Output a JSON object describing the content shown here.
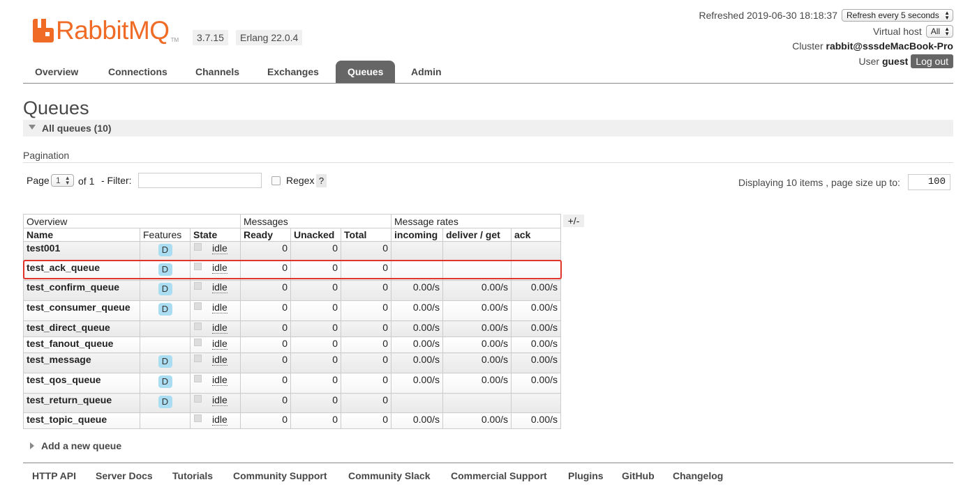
{
  "header": {
    "logo_text": "RabbitMQ",
    "logo_tm": "TM",
    "version": "3.7.15",
    "erlang": "Erlang 22.0.4"
  },
  "topright": {
    "refreshed_label": "Refreshed 2019-06-30 18:18:37",
    "refresh_select": "Refresh every 5 seconds",
    "vhost_label": "Virtual host",
    "vhost_select": "All",
    "cluster_label": "Cluster",
    "cluster_name": "rabbit@sssdeMacBook-Pro",
    "user_label": "User",
    "user_name": "guest",
    "logout": "Log out"
  },
  "tabs": [
    {
      "label": "Overview",
      "active": false
    },
    {
      "label": "Connections",
      "active": false
    },
    {
      "label": "Channels",
      "active": false
    },
    {
      "label": "Exchanges",
      "active": false
    },
    {
      "label": "Queues",
      "active": true
    },
    {
      "label": "Admin",
      "active": false
    }
  ],
  "page": {
    "title": "Queues",
    "section": "All queues (10)",
    "pagination_title": "Pagination",
    "page_label": "Page",
    "page_value": "1",
    "of_label": "of 1",
    "filter_label": "- Filter:",
    "filter_value": "",
    "regex_label": "Regex",
    "help": "?",
    "displaying": "Displaying 10 items , page size up to:",
    "page_size": "100",
    "plusminus": "+/-",
    "add_queue": "Add a new queue"
  },
  "table": {
    "groups": [
      "Overview",
      "Messages",
      "Message rates"
    ],
    "columns": [
      "Name",
      "Features",
      "State",
      "Ready",
      "Unacked",
      "Total",
      "incoming",
      "deliver / get",
      "ack"
    ],
    "rows": [
      {
        "name": "test001",
        "durable": true,
        "state": "idle",
        "ready": "0",
        "unacked": "0",
        "total": "0",
        "incoming": "",
        "deliver": "",
        "ack": ""
      },
      {
        "name": "test_ack_queue",
        "durable": true,
        "state": "idle",
        "ready": "0",
        "unacked": "0",
        "total": "0",
        "incoming": "",
        "deliver": "",
        "ack": ""
      },
      {
        "name": "test_confirm_queue",
        "durable": true,
        "state": "idle",
        "ready": "0",
        "unacked": "0",
        "total": "0",
        "incoming": "0.00/s",
        "deliver": "0.00/s",
        "ack": "0.00/s"
      },
      {
        "name": "test_consumer_queue",
        "durable": true,
        "state": "idle",
        "ready": "0",
        "unacked": "0",
        "total": "0",
        "incoming": "0.00/s",
        "deliver": "0.00/s",
        "ack": "0.00/s"
      },
      {
        "name": "test_direct_queue",
        "durable": false,
        "state": "idle",
        "ready": "0",
        "unacked": "0",
        "total": "0",
        "incoming": "0.00/s",
        "deliver": "0.00/s",
        "ack": "0.00/s"
      },
      {
        "name": "test_fanout_queue",
        "durable": false,
        "state": "idle",
        "ready": "0",
        "unacked": "0",
        "total": "0",
        "incoming": "0.00/s",
        "deliver": "0.00/s",
        "ack": "0.00/s"
      },
      {
        "name": "test_message",
        "durable": true,
        "state": "idle",
        "ready": "0",
        "unacked": "0",
        "total": "0",
        "incoming": "0.00/s",
        "deliver": "0.00/s",
        "ack": "0.00/s"
      },
      {
        "name": "test_qos_queue",
        "durable": true,
        "state": "idle",
        "ready": "0",
        "unacked": "0",
        "total": "0",
        "incoming": "0.00/s",
        "deliver": "0.00/s",
        "ack": "0.00/s"
      },
      {
        "name": "test_return_queue",
        "durable": true,
        "state": "idle",
        "ready": "0",
        "unacked": "0",
        "total": "0",
        "incoming": "",
        "deliver": "",
        "ack": ""
      },
      {
        "name": "test_topic_queue",
        "durable": false,
        "state": "idle",
        "ready": "0",
        "unacked": "0",
        "total": "0",
        "incoming": "0.00/s",
        "deliver": "0.00/s",
        "ack": "0.00/s"
      }
    ],
    "durable_badge": "D"
  },
  "footer": [
    "HTTP API",
    "Server Docs",
    "Tutorials",
    "Community Support",
    "Community Slack",
    "Commercial Support",
    "Plugins",
    "GitHub",
    "Changelog"
  ],
  "colors": {
    "brand": "#f06b25",
    "active_tab": "#666666",
    "durable_badge": "#aaddf2",
    "highlight": "#e0352b"
  }
}
